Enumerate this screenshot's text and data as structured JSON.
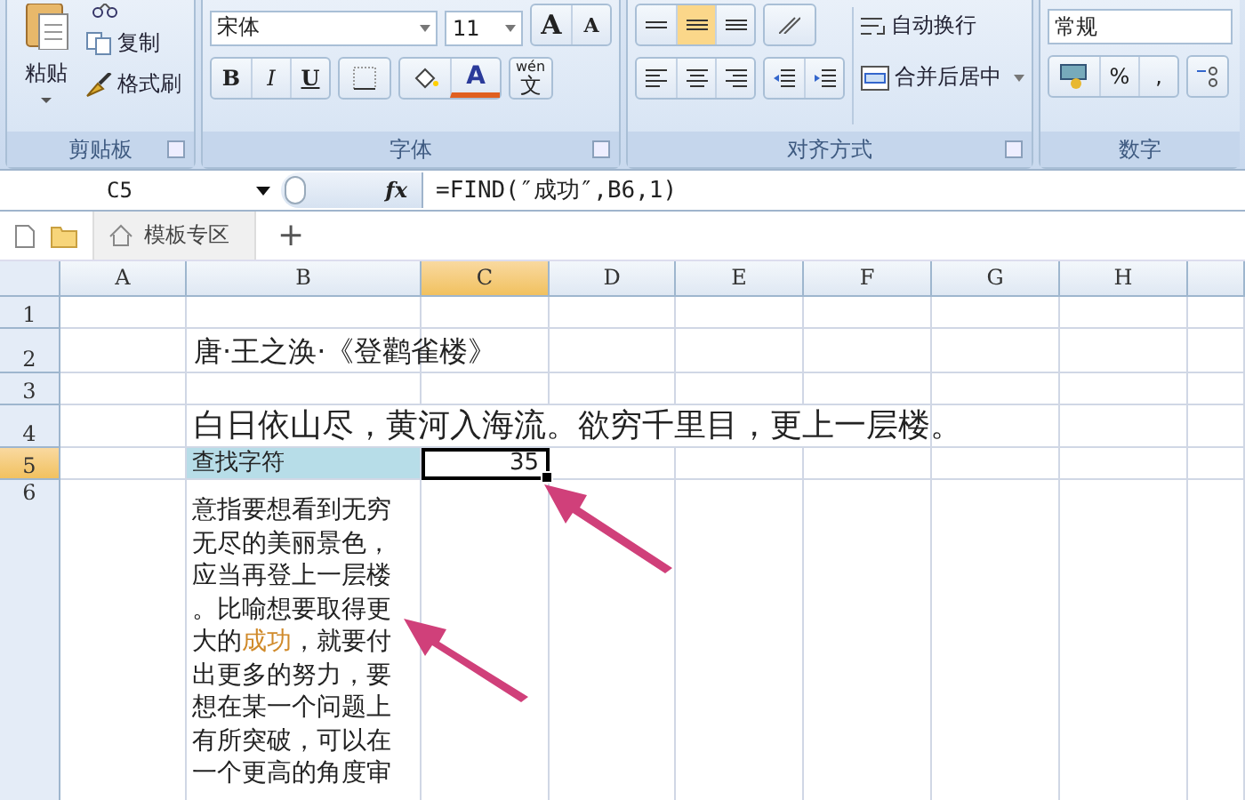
{
  "ribbon": {
    "clipboard": {
      "paste": "粘贴",
      "copy": "复制",
      "format_painter": "格式刷",
      "label": "剪贴板"
    },
    "font": {
      "family": "宋体",
      "size": "11",
      "grow": "A",
      "shrink": "A",
      "bold": "B",
      "italic": "I",
      "underline": "U",
      "color_letter": "A",
      "phonetic_top": "wén",
      "phonetic_char": "文",
      "label": "字体"
    },
    "alignment": {
      "wrap": "自动换行",
      "merge": "合并后居中",
      "label": "对齐方式"
    },
    "number": {
      "format": "常规",
      "percent": "%",
      "comma": ",",
      "label": "数字"
    }
  },
  "formula_bar": {
    "cell": "C5",
    "fx": "fx",
    "formula": "=FIND(″成功″,B6,1)"
  },
  "tabs": [
    {
      "label": "模板专区",
      "selected": true
    }
  ],
  "new_tab": "+",
  "columns": [
    {
      "label": "A",
      "selected": false
    },
    {
      "label": "B",
      "selected": false
    },
    {
      "label": "C",
      "selected": true
    },
    {
      "label": "D",
      "selected": false
    },
    {
      "label": "E",
      "selected": false
    },
    {
      "label": "F",
      "selected": false
    },
    {
      "label": "G",
      "selected": false
    },
    {
      "label": "H",
      "selected": false
    }
  ],
  "rows": [
    {
      "label": "1",
      "selected": false,
      "cells": []
    },
    {
      "label": "2",
      "selected": false,
      "cells": [
        null,
        {
          "kind": "title",
          "text": "唐·王之涣·《登鹳雀楼》",
          "highlighted": false,
          "active": false
        }
      ]
    },
    {
      "label": "3",
      "selected": false,
      "cells": []
    },
    {
      "label": "4",
      "selected": false,
      "cells": [
        null,
        {
          "kind": "verse",
          "text": "白日依山尽，黄河入海流。欲穷千里目，更上一层楼。",
          "highlighted": false,
          "active": false
        }
      ]
    },
    {
      "label": "5",
      "selected": true,
      "cells": [
        null,
        {
          "kind": "label",
          "text": "查找字符",
          "highlighted": true,
          "active": false
        },
        {
          "kind": "number",
          "text": "35",
          "highlighted": false,
          "active": true
        }
      ]
    },
    {
      "label": "6",
      "selected": false,
      "cells": [
        null,
        {
          "kind": "paragraph",
          "segments": [
            {
              "text": "意指要想看到无穷无尽的美丽景色，应当再登上一层楼。比喻想要取得更大的",
              "highlighted": false
            },
            {
              "text": "成功",
              "highlighted": true
            },
            {
              "text": "，就要付出更多的努力，要想在某一个问题上有所突破，可以在一个更高的角度审",
              "highlighted": false
            }
          ],
          "highlighted": false,
          "active": false
        }
      ]
    }
  ]
}
